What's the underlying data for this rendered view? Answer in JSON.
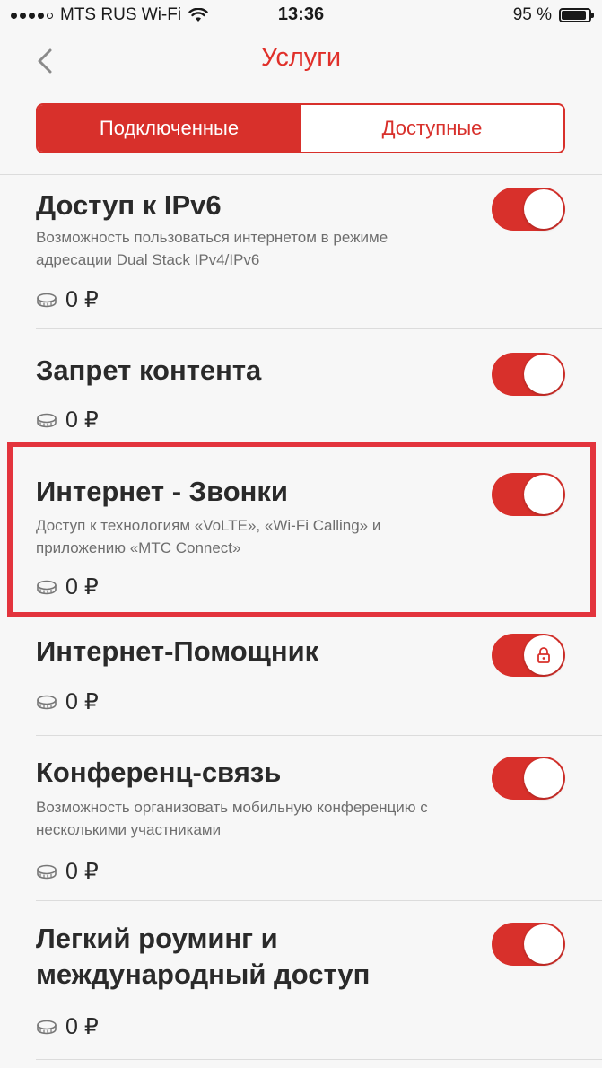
{
  "status_bar": {
    "carrier": "MTS RUS Wi-Fi",
    "time": "13:36",
    "battery_percent": "95 %",
    "battery_level": 0.95
  },
  "nav": {
    "back_icon": "chevron-left-icon",
    "title": "Услуги"
  },
  "tabs": [
    {
      "label": "Подключенные",
      "active": true
    },
    {
      "label": "Доступные",
      "active": false
    }
  ],
  "services": [
    {
      "title": "Доступ к IPv6",
      "description": "Возможность пользоваться интернетом в режиме адресации Dual Stack IPv4/IPv6",
      "price": "0 ₽",
      "enabled": true,
      "locked": false
    },
    {
      "title": "Запрет контента",
      "description": "",
      "price": "0 ₽",
      "enabled": true,
      "locked": false
    },
    {
      "title": "Интернет - Звонки",
      "description": "Доступ  к технологиям «VoLTE», «Wi-Fi Calling» и приложению «МТС Connect»",
      "price": "0 ₽",
      "enabled": true,
      "locked": false,
      "highlighted": true
    },
    {
      "title": "Интернет-Помощник",
      "description": "",
      "price": "0 ₽",
      "enabled": true,
      "locked": true
    },
    {
      "title": "Конференц-связь",
      "description": "Возможность организовать мобильную конференцию с несколькими участниками",
      "price": "0 ₽",
      "enabled": true,
      "locked": false
    },
    {
      "title": "Легкий роуминг и международный доступ",
      "description": "",
      "price": "0 ₽",
      "enabled": true,
      "locked": false
    }
  ],
  "colors": {
    "accent": "#d8302b",
    "highlight_border": "#e3343d",
    "background": "#f7f7f7"
  }
}
